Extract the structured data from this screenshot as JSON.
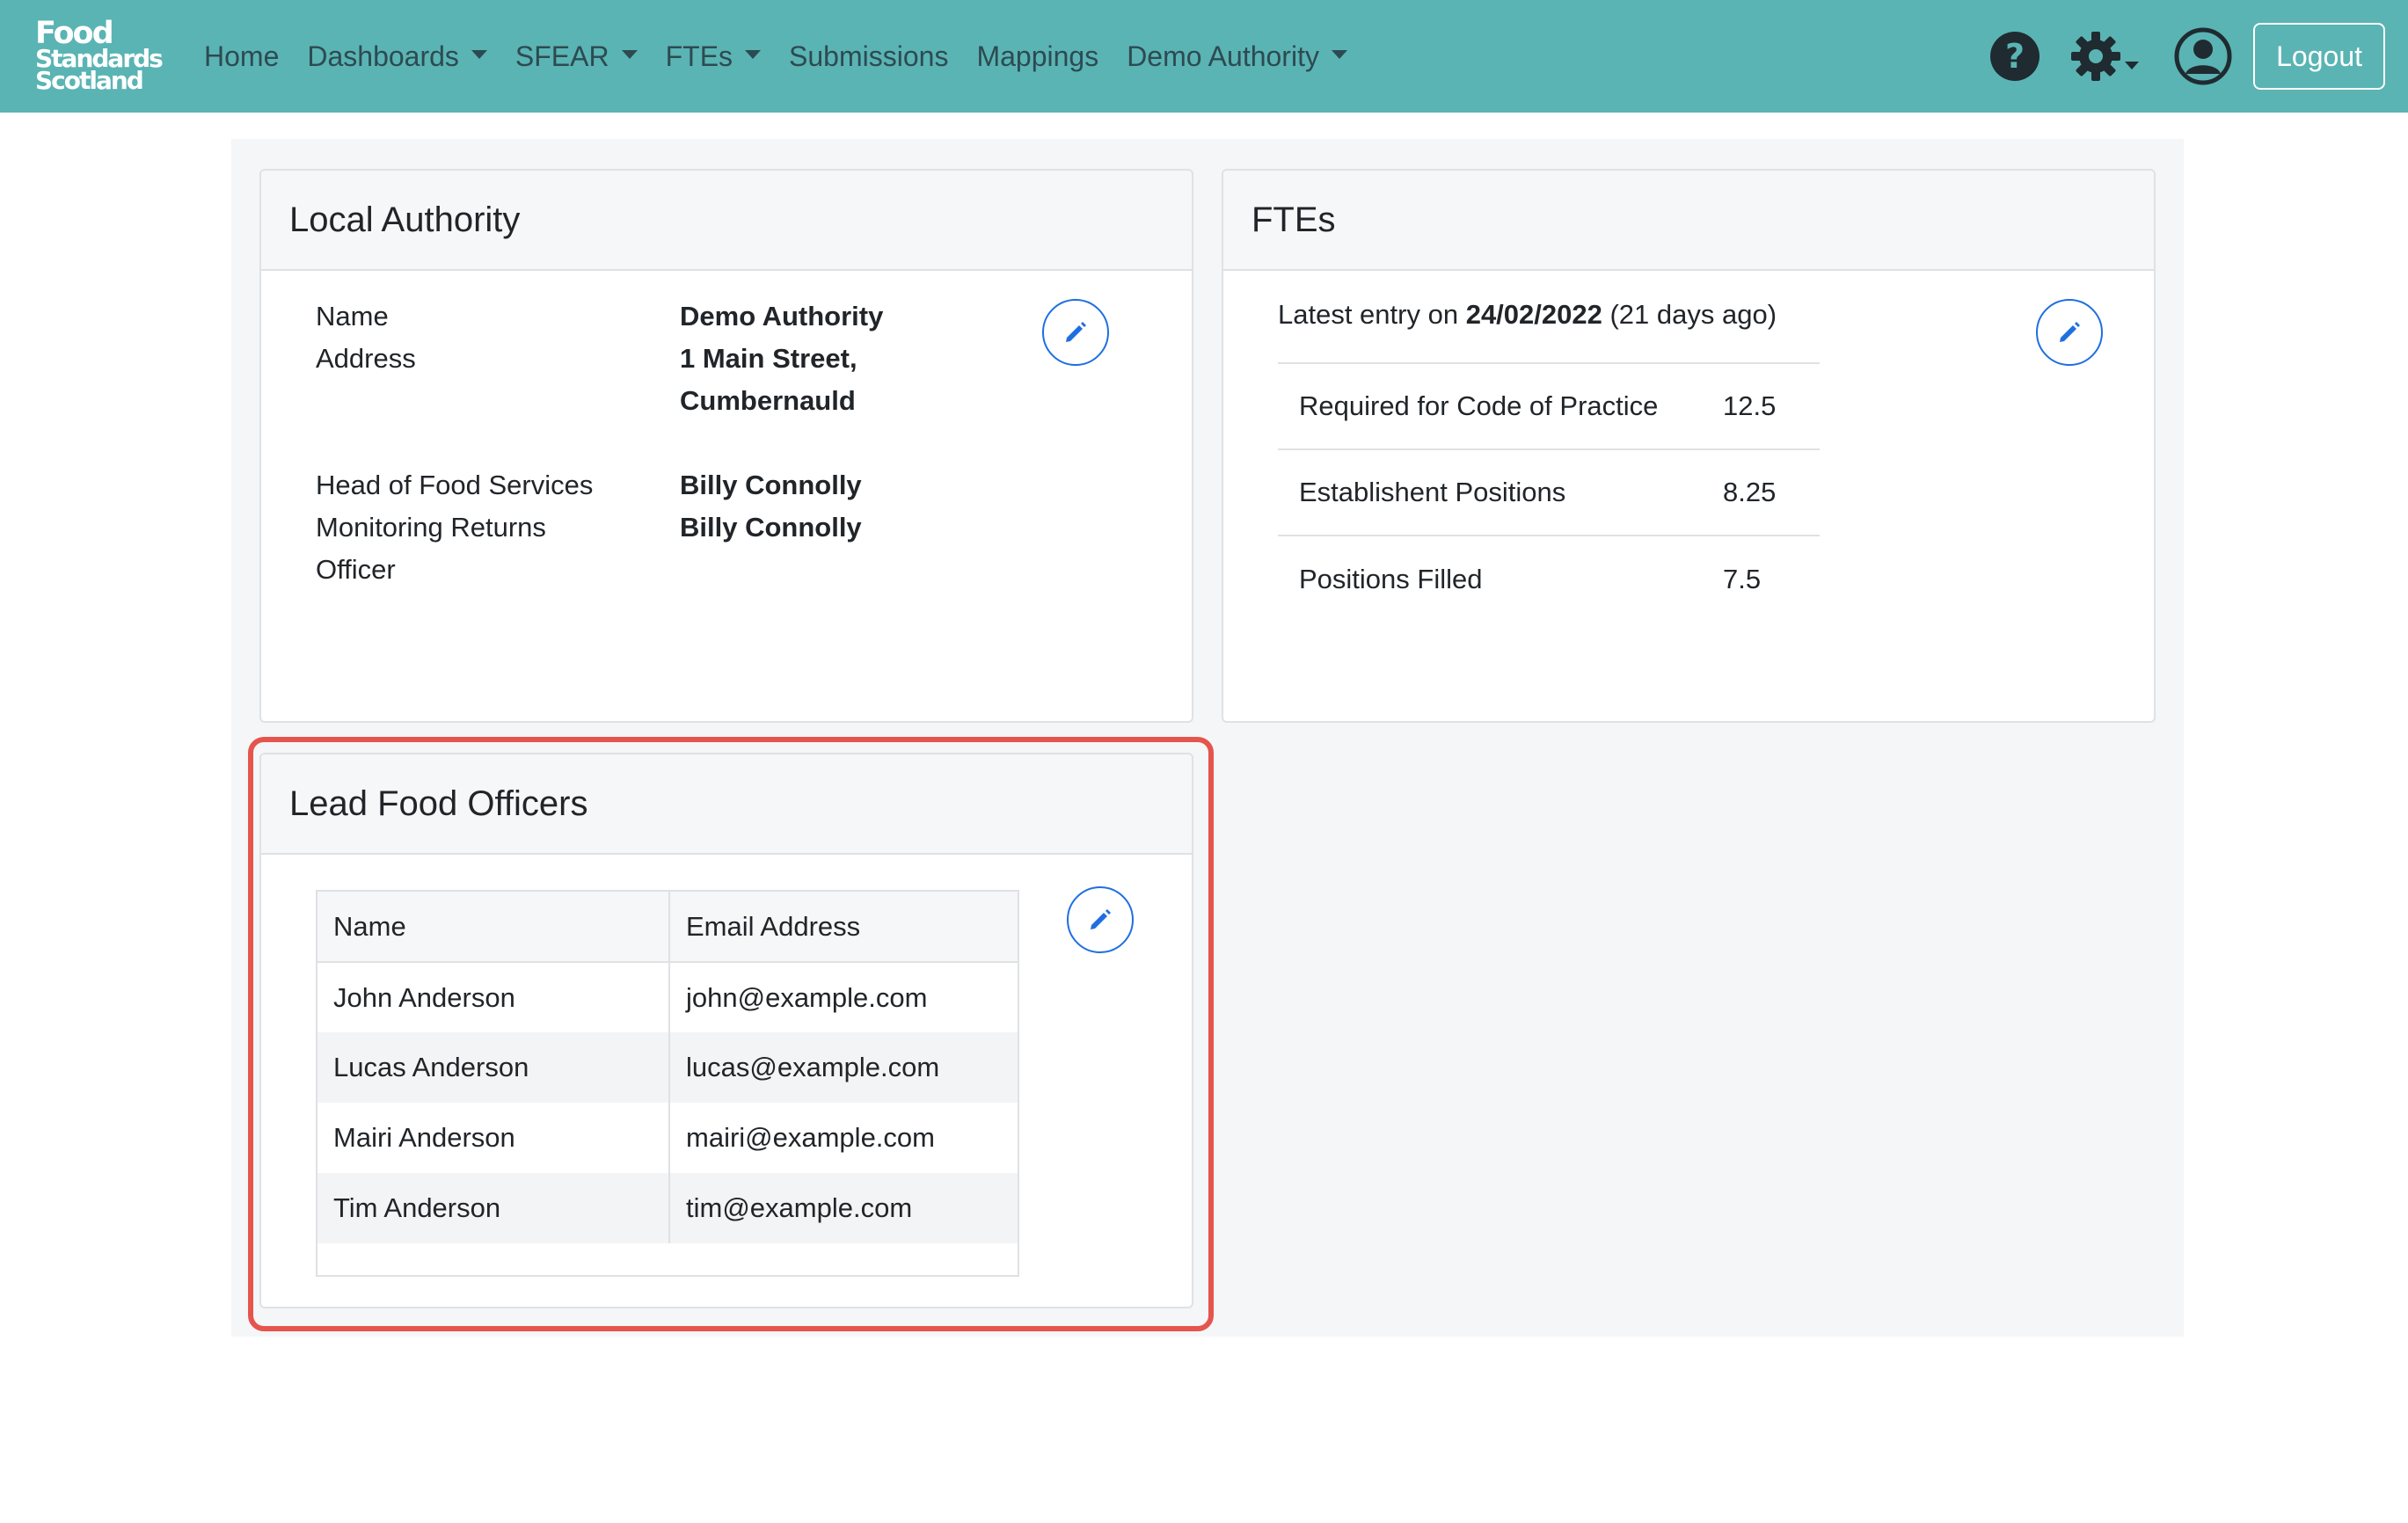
{
  "brand": {
    "line1": "Food",
    "line2": "Standards",
    "line3": "Scotland",
    "color": "#5ab4b3"
  },
  "nav": {
    "items": [
      {
        "label": "Home",
        "dropdown": false
      },
      {
        "label": "Dashboards",
        "dropdown": true
      },
      {
        "label": "SFEAR",
        "dropdown": true
      },
      {
        "label": "FTEs",
        "dropdown": true
      },
      {
        "label": "Submissions",
        "dropdown": false
      },
      {
        "label": "Mappings",
        "dropdown": false
      },
      {
        "label": "Demo Authority",
        "dropdown": true
      }
    ],
    "logout_label": "Logout",
    "icons": [
      "help-icon",
      "gear-icon",
      "user-icon"
    ]
  },
  "local_authority": {
    "title": "Local Authority",
    "name_label": "Name",
    "address_label": "Address",
    "name_value": "Demo Authority",
    "address_line1": "1 Main Street,",
    "address_line2": "Cumbernauld",
    "head_label": "Head of Food Services",
    "mro_label_line1": "Monitoring Returns",
    "mro_label_line2": "Officer",
    "head_value": "Billy Connolly",
    "mro_value": "Billy Connolly"
  },
  "ftes": {
    "title": "FTEs",
    "latest_prefix": "Latest entry on",
    "latest_date": "24/02/2022",
    "latest_suffix": "(21 days ago)",
    "rows": [
      {
        "label": "Required for Code of Practice",
        "value": "12.5"
      },
      {
        "label": "Establishent Positions",
        "value": "8.25"
      },
      {
        "label": "Positions Filled",
        "value": "7.5"
      }
    ]
  },
  "lead_food_officers": {
    "title": "Lead Food Officers",
    "columns": [
      "Name",
      "Email Address"
    ],
    "rows": [
      {
        "name": "John Anderson",
        "email": "john@example.com"
      },
      {
        "name": "Lucas Anderson",
        "email": "lucas@example.com"
      },
      {
        "name": "Mairi Anderson",
        "email": "mairi@example.com"
      },
      {
        "name": "Tim Anderson",
        "email": "tim@example.com"
      }
    ]
  },
  "colors": {
    "accent": "#1f6fe0",
    "highlight": "#e5554d"
  }
}
